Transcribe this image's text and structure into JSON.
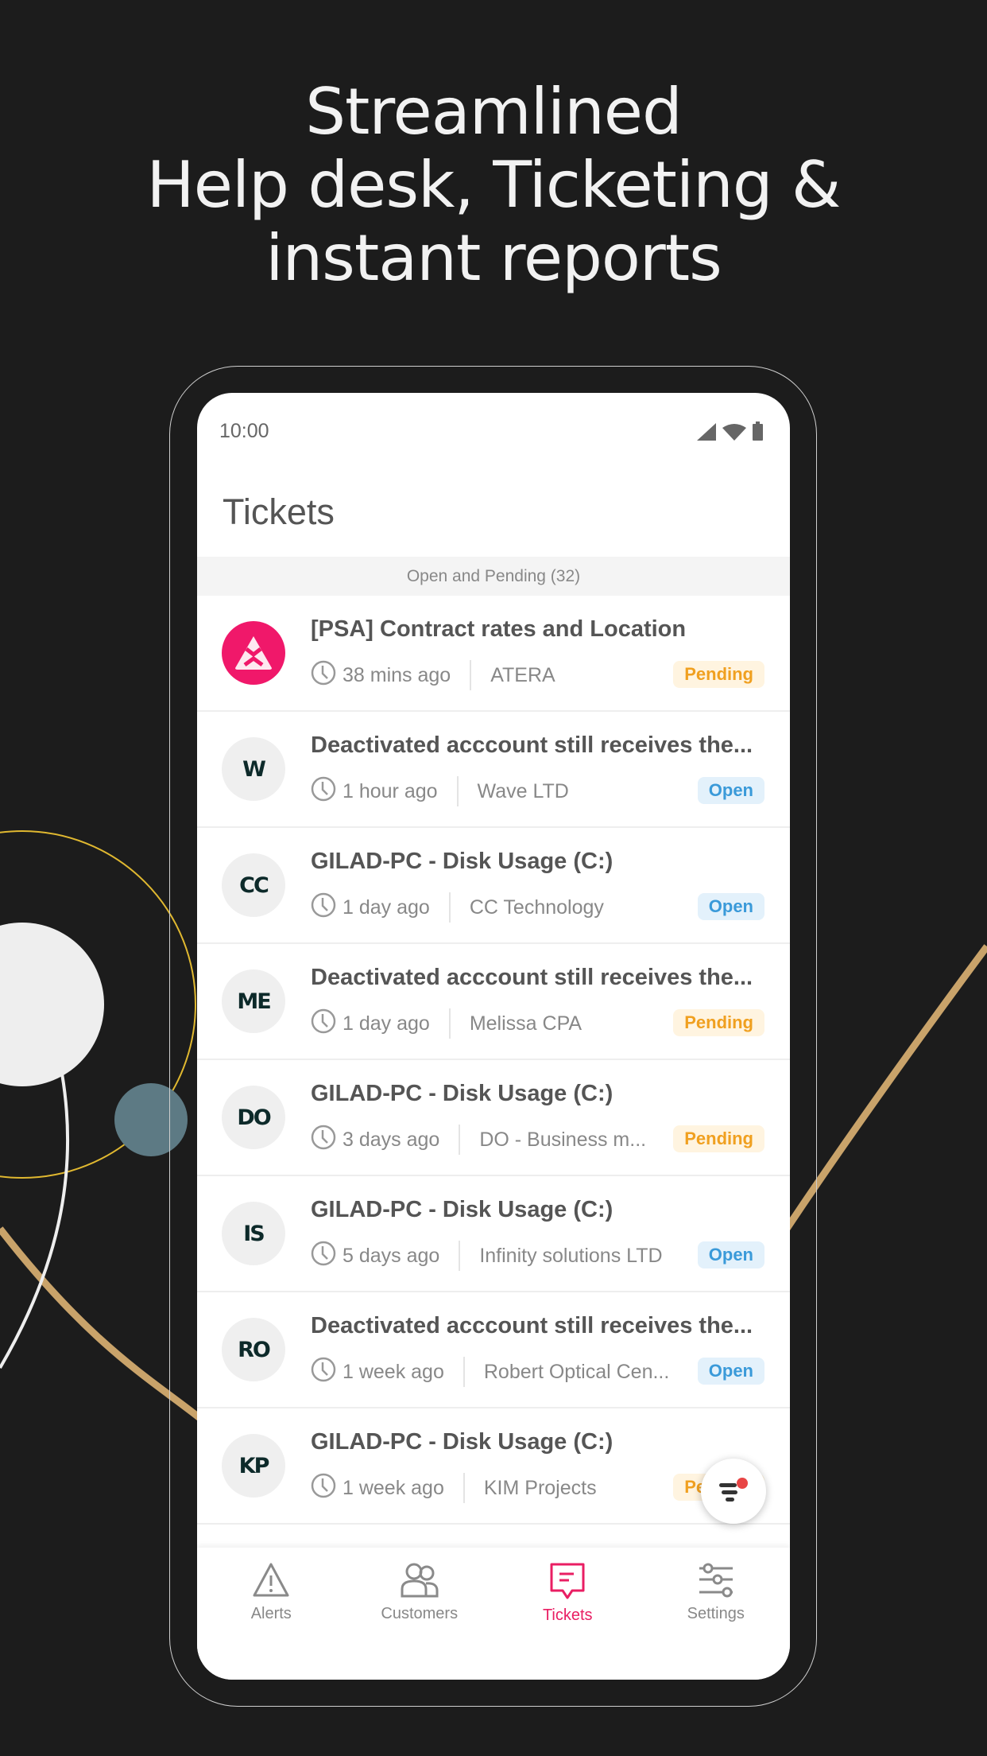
{
  "headline": {
    "line1": "Streamlined",
    "line2": "Help desk, Ticketing &",
    "line3": "instant reports"
  },
  "status_bar": {
    "time": "10:00",
    "icons": [
      "signal-icon",
      "wifi-icon",
      "battery-icon"
    ]
  },
  "page": {
    "title": "Tickets",
    "section_header": "Open and Pending (32)"
  },
  "tickets": [
    {
      "avatar": "",
      "avatar_icon": "atera-logo-icon",
      "title": "[PSA] Contract rates and Location",
      "time": "38 mins ago",
      "company": "ATERA",
      "status": "Pending"
    },
    {
      "avatar": "W",
      "title": "Deactivated acccount still receives the...",
      "time": "1 hour ago",
      "company": "Wave LTD",
      "status": "Open"
    },
    {
      "avatar": "CC",
      "title": "GILAD-PC - Disk Usage (C:)",
      "time": "1 day ago",
      "company": "CC Technology",
      "status": "Open"
    },
    {
      "avatar": "ME",
      "title": "Deactivated acccount still receives the...",
      "time": "1 day ago",
      "company": "Melissa CPA",
      "status": "Pending"
    },
    {
      "avatar": "DO",
      "title": "GILAD-PC - Disk Usage (C:)",
      "time": "3 days ago",
      "company": "DO - Business m...",
      "status": "Pending"
    },
    {
      "avatar": "IS",
      "title": "GILAD-PC - Disk Usage (C:)",
      "time": "5 days ago",
      "company": "Infinity solutions LTD",
      "status": "Open"
    },
    {
      "avatar": "RO",
      "title": "Deactivated acccount still receives the...",
      "time": "1 week ago",
      "company": "Robert Optical Cen...",
      "status": "Open"
    },
    {
      "avatar": "KP",
      "title": "GILAD-PC - Disk Usage (C:)",
      "time": "1 week ago",
      "company": "KIM Projects",
      "status": "Pending"
    }
  ],
  "nav": [
    {
      "label": "Alerts",
      "icon": "alert-triangle-icon"
    },
    {
      "label": "Customers",
      "icon": "users-icon"
    },
    {
      "label": "Tickets",
      "icon": "ticket-message-icon",
      "active": true
    },
    {
      "label": "Settings",
      "icon": "sliders-icon"
    }
  ],
  "colors": {
    "accent": "#e91e63",
    "pending": "#f0a020",
    "open": "#3a9ad9",
    "background": "#1c1c1c"
  }
}
